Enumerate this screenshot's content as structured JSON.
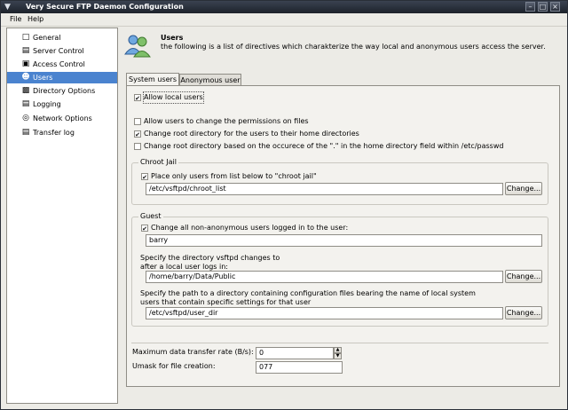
{
  "window": {
    "title": "Very Secure FTP Daemon Configuration"
  },
  "menu": {
    "file": "File",
    "help": "Help"
  },
  "sidebar": {
    "items": [
      {
        "label": "General",
        "icon": "general-icon"
      },
      {
        "label": "Server Control",
        "icon": "server-icon"
      },
      {
        "label": "Access Control",
        "icon": "access-icon"
      },
      {
        "label": "Users",
        "icon": "users-icon"
      },
      {
        "label": "Directory Options",
        "icon": "folder-icon"
      },
      {
        "label": "Logging",
        "icon": "log-icon"
      },
      {
        "label": "Network Options",
        "icon": "network-icon"
      },
      {
        "label": "Transfer log",
        "icon": "document-icon"
      }
    ],
    "selected_index": 3
  },
  "header": {
    "title": "Users",
    "description": "the following is a list of directives which charakterize the way local and anonymous users access the server."
  },
  "tabs": [
    {
      "label": "System users"
    },
    {
      "label": "Anonymous user"
    }
  ],
  "options": {
    "allow_local": {
      "label": "Allow local users",
      "checked": true
    },
    "change_permissions": {
      "label": "Allow users to change the permissions on files",
      "checked": false
    },
    "chroot_home": {
      "label": "Change root directory for the users to their home directories",
      "checked": true
    },
    "chroot_passwd": {
      "label": "Change root directory based on the occurece of the \".\" in the home directory field within /etc/passwd",
      "checked": false
    }
  },
  "chroot_jail": {
    "title": "Chroot Jail",
    "option": {
      "label": "Place only users from list below to \"chroot jail\"",
      "checked": true
    },
    "path": "/etc/vsftpd/chroot_list",
    "button": "Change..."
  },
  "guest": {
    "title": "Guest",
    "option": {
      "label": "Change all non-anonymous users logged in to the user:",
      "checked": true
    },
    "user": "barry",
    "dir_label_line1": "Specify the directory vsftpd changes to",
    "dir_label_line2": "after a local user logs in:",
    "dir_path": "/home/barry/Data/Public",
    "dir_button": "Change...",
    "config_label_line1": "Specify the path to a directory containing configuration files bearing the name of local system",
    "config_label_line2": "users that contain specific settings for that user",
    "config_path": "/etc/vsftpd/user_dir",
    "config_button": "Change..."
  },
  "limits": {
    "rate_label": "Maximum data transfer rate (B/s):",
    "rate_value": "0",
    "umask_label": "Umask for file creation:",
    "umask_value": "077"
  }
}
